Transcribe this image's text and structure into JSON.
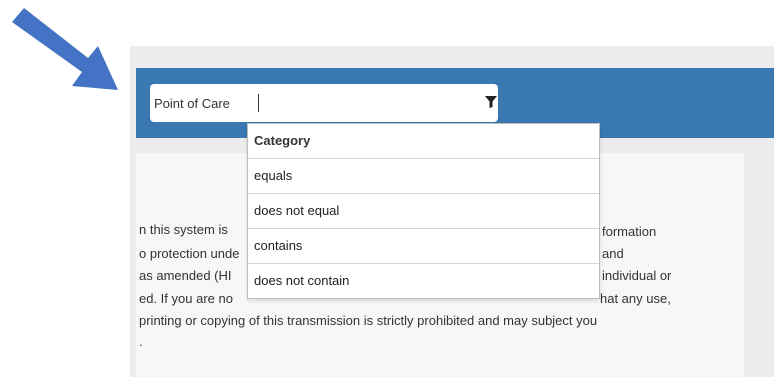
{
  "annotation": {
    "arrow_icon": "arrow-right-down-icon",
    "arrow_color": "#4472c4"
  },
  "colors": {
    "header_blue": "#3a78b3",
    "page_gray": "#ececec",
    "panel": "#f7f7f7"
  },
  "filter": {
    "label": "Point of Care",
    "value": "",
    "icon": "filter-icon"
  },
  "dropdown": {
    "header": "Category",
    "options": [
      "equals",
      "does not equal",
      "contains",
      "does not contain"
    ]
  },
  "body_text": {
    "left_lines": [
      "n this system is",
      "o protection unde",
      "as amended (HI",
      "ed. If you are no",
      "printing or copying of this transmission is strictly prohibited and may subject you",
      "."
    ],
    "right_lines": [
      "formation",
      "and",
      "individual or",
      "hat any use,"
    ]
  }
}
